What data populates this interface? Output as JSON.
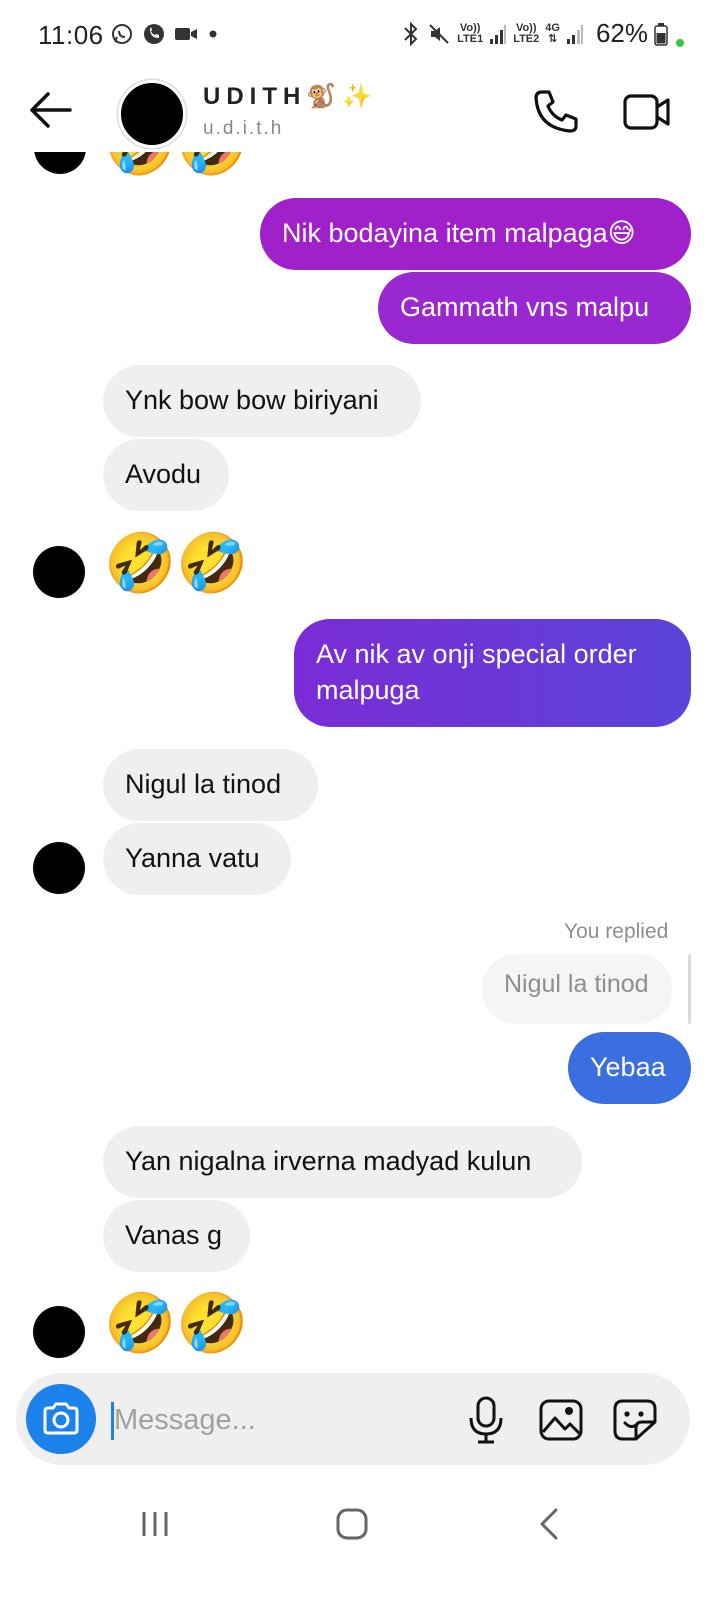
{
  "status_bar": {
    "time": "11:06",
    "battery": "62%",
    "sim1_top": "Vo))",
    "sim1_bottom": "LTE1",
    "sim2_top": "Vo))",
    "sim2_bottom": "LTE2",
    "net_type": "4G"
  },
  "header": {
    "name": "UDITH🐒✨",
    "username": "u.d.i.t.h"
  },
  "messages": {
    "m1": "Nik bodayina item malpaga😅",
    "m2": "Gammath vns malpu",
    "m3": "Ynk bow bow biriyani",
    "m4": "Avodu",
    "m5": "🤣🤣",
    "m6_line1": "Av nik av onji special order",
    "m6_line2": "malpuga",
    "m7": "Nigul la tinod",
    "m8": "Yanna vatu",
    "reply_label": "You replied",
    "reply_quote": "Nigul la tinod",
    "m9": "Yebaa",
    "m10": "Yan nigalna irverna madyad kulun",
    "m11": "Vanas g",
    "m12": "🤣🤣",
    "top_partial": "🤣🤣"
  },
  "composer": {
    "placeholder": "Message..."
  },
  "colors": {
    "outgoing_purple": "#a120c8",
    "outgoing_violet": "#6a3ad8",
    "outgoing_blue": "#3b6fe0",
    "incoming": "#efefef",
    "camera": "#1b82ec"
  }
}
